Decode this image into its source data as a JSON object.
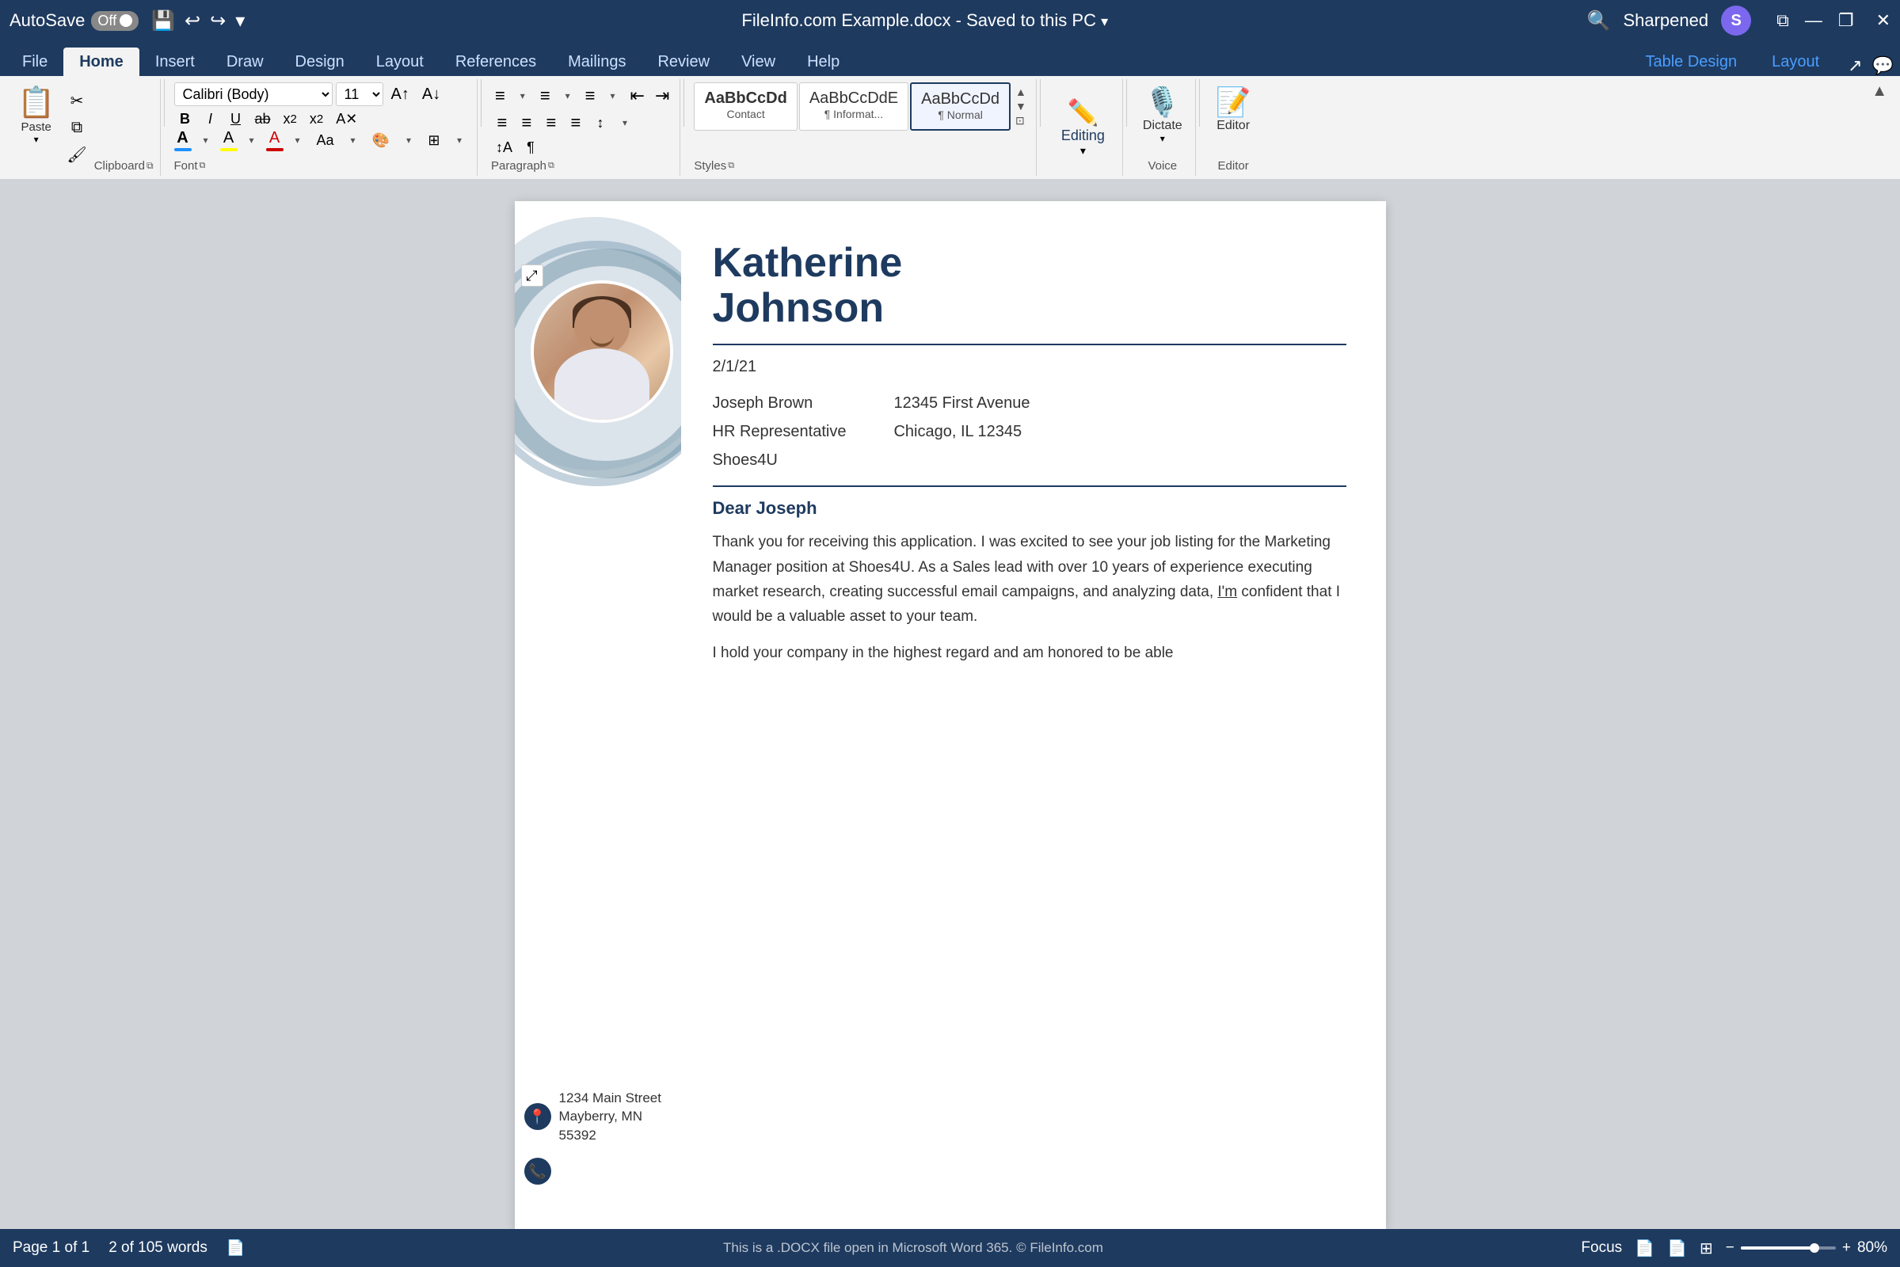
{
  "titlebar": {
    "autosave_label": "AutoSave",
    "autosave_state": "Off",
    "filename": "FileInfo.com Example.docx",
    "save_status": "Saved to this PC",
    "search_placeholder": "Search",
    "user_name": "Sharpened",
    "user_initial": "S",
    "minimize_icon": "—",
    "restore_icon": "❐",
    "close_icon": "✕"
  },
  "ribbon": {
    "tabs": [
      "File",
      "Home",
      "Insert",
      "Draw",
      "Design",
      "Layout",
      "References",
      "Mailings",
      "Review",
      "View",
      "Help",
      "Table Design",
      "Layout"
    ],
    "active_tab": "Home",
    "blue_tabs": [
      "Table Design",
      "Layout"
    ],
    "clipboard": {
      "paste_label": "Paste",
      "cut_label": "✂",
      "copy_label": "⧉",
      "format_painter_label": "🖌",
      "group_label": "Clipboard"
    },
    "font": {
      "font_name": "Calibri (Body)",
      "font_size": "11",
      "bold": "B",
      "italic": "I",
      "underline": "U",
      "strikethrough": "ab",
      "subscript": "x₂",
      "superscript": "x²",
      "clear_format": "A",
      "group_label": "Font"
    },
    "paragraph": {
      "bullets": "≡",
      "numbering": "≡",
      "multilevel": "≡",
      "decrease_indent": "⇤",
      "increase_indent": "⇥",
      "align_left": "≡",
      "align_center": "≡",
      "align_right": "≡",
      "justify": "≡",
      "line_spacing": "↕",
      "sort": "↕A",
      "show_marks": "¶",
      "group_label": "Paragraph"
    },
    "styles": {
      "items": [
        {
          "name": "AaBbCcDd",
          "label": "Contact"
        },
        {
          "name": "AaBbCcDdE",
          "label": "¶ Informat..."
        },
        {
          "name": "AaBbCcDd",
          "label": "¶ Normal"
        }
      ],
      "selected_index": 2,
      "group_label": "Styles"
    },
    "voice": {
      "dictate_label": "Dictate",
      "group_label": "Voice"
    },
    "editor": {
      "editor_label": "Editor",
      "group_label": "Editor"
    },
    "editing": {
      "mode_label": "Editing",
      "dropdown_icon": "▾"
    }
  },
  "document": {
    "name_line1": "Katherine",
    "name_line2": "Johnson",
    "date": "2/1/21",
    "recipient_name": "Joseph Brown",
    "recipient_title": "HR Representative",
    "recipient_company": "Shoes4U",
    "recipient_address": "12345 First Avenue",
    "recipient_city": "Chicago, IL 12345",
    "salutation": "Dear Joseph",
    "body_paragraph1": "Thank you for receiving this application.  I was excited to see your job listing for the Marketing Manager position at Shoes4U.  As a Sales lead with over 10 years of experience executing market research, creating successful email campaigns, and analyzing data, I'm confident that I would be a valuable asset to your team.",
    "body_paragraph2": "I hold your company in the highest regard and am honored to be able",
    "contact_address_line1": "1234 Main Street",
    "contact_address_line2": "Mayberry, MN 55392",
    "move_handle": "⤢"
  },
  "statusbar": {
    "page_info": "Page 1 of 1",
    "word_count": "2 of 105 words",
    "proofing_icon": "📄",
    "focus_label": "Focus",
    "zoom_percent": "80%"
  }
}
